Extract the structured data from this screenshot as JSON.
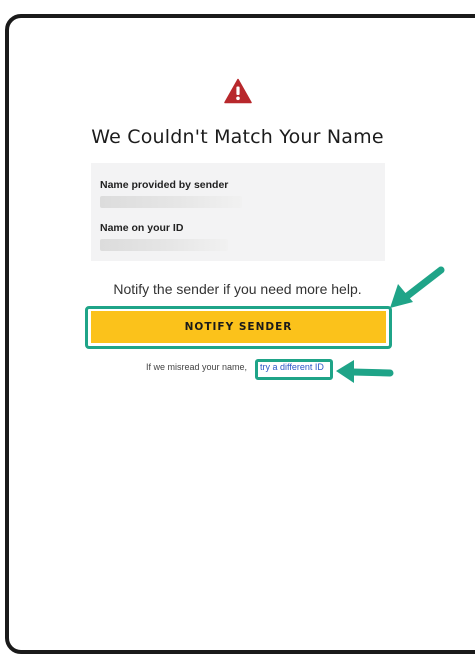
{
  "title": "We Couldn't Match Your Name",
  "info": {
    "sender_name_label": "Name provided by sender",
    "id_name_label": "Name on your ID"
  },
  "notify_message": "Notify the sender if you need more help.",
  "notify_button_label": "NOTIFY SENDER",
  "misread_text": "If we misread your name,",
  "different_id_link": "try a different ID",
  "colors": {
    "warning_icon": "#b8282c",
    "button": "#fbc21b",
    "highlight": "#1fa488",
    "link": "#2a56c6"
  },
  "icons": [
    "warning-triangle-icon",
    "arrow-pointer-icon"
  ]
}
